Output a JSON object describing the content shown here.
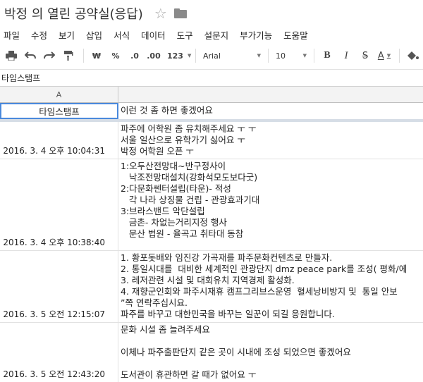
{
  "document": {
    "title": "박정 의 열린 공약실(응답)"
  },
  "menu": [
    "파일",
    "수정",
    "보기",
    "삽입",
    "서식",
    "데이터",
    "도구",
    "설문지",
    "부가기능",
    "도움말"
  ],
  "toolbar": {
    "currency_label": "₩",
    "percent_label": "%",
    "decrease_decimal_label": ".0",
    "increase_decimal_label": ".00",
    "number_format_label": "123",
    "font_family": "Arial",
    "font_size": "10",
    "bold_label": "B",
    "italic_label": "I",
    "strike_label": "S",
    "text_color_label": "A"
  },
  "formula_bar": {
    "value": "타임스탬프"
  },
  "columns": [
    {
      "label": "A"
    }
  ],
  "header_row": {
    "a": "타임스탬프",
    "b": "이런 것 좀 하면 좋겠어요"
  },
  "rows": [
    {
      "timestamp": "2016. 3. 4 오후 10:04:31",
      "response": "파주에 어학원 좀 유치해주세요 ㅜ ㅜ\n서울 일산으로 유학가기 싫어요 ㅜ\n박정 어학원 오픈 ㅜ"
    },
    {
      "timestamp": "2016. 3. 4 오후 10:38:40",
      "response": "1:오두산전망대~반구정사이\n   낙조전망대설치(강화석모도보다굿)\n2:다문화쎈터설립(타운)- 적성\n   각 나라 상징물 건립 - 관광효과기대\n3:브라스밴드 악단설립\n   금촌- 차없는거리지정 행사\n   문산 법원 - 율곡고 취타대 동참"
    },
    {
      "timestamp": "2016. 3. 5 오전 12:15:07",
      "response": "1. 황포돗배와 임진강 가곡재를 파주문화컨텐츠로 만들자.\n2. 통일시대를  대비한 세계적인 관광단지 dmz peace park를 조성( 평화/에\n3. 레저관련 시설 및 대회유치 지역경제 활성화.\n4. 재향군인회와 파주시재휴 캠프그리브스운영  혈세낭비방지 및  통일 안보\n”쪽 연락주십시요.\n파주를 바꾸고 대한민국을 바꾸는 일꾼이 되길 응원합니다."
    },
    {
      "timestamp": "2016. 3. 5 오전 12:43:20",
      "response": "문화 시설 좀 늘려주세요\n\n이체나 파주출판단지 같은 곳이 시내에 조성 되었으면 좋겠어요\n\n도서관이 휴관하면 갈 때가 없어요 ㅜ"
    }
  ]
}
